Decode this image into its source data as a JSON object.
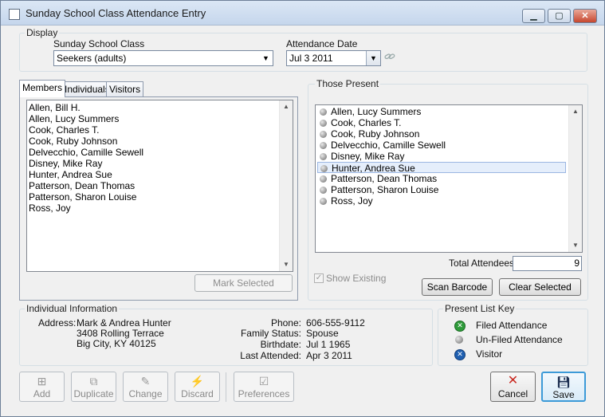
{
  "window": {
    "title": "Sunday School Class Attendance Entry",
    "controls": {
      "minimize": "▁",
      "maximize": "▢",
      "close": "✕"
    }
  },
  "display": {
    "group_label": "Display",
    "class_label": "Sunday School Class",
    "class_value": "Seekers (adults)",
    "date_label": "Attendance Date",
    "date_value": "Jul 3 2011"
  },
  "tabs": [
    "Members",
    "Individuals",
    "Visitors"
  ],
  "members": [
    "Allen, Bill H.",
    "Allen, Lucy Summers",
    "Cook, Charles T.",
    "Cook, Ruby Johnson",
    "Delvecchio, Camille Sewell",
    "Disney, Mike Ray",
    "Hunter, Andrea Sue",
    "Patterson, Dean Thomas",
    "Patterson, Sharon Louise",
    "Ross, Joy"
  ],
  "mark_selected_label": "Mark Selected",
  "present": {
    "group_label": "Those Present",
    "items": [
      "Allen, Lucy Summers",
      "Cook, Charles T.",
      "Cook, Ruby Johnson",
      "Delvecchio, Camille Sewell",
      "Disney, Mike Ray",
      "Hunter, Andrea Sue",
      "Patterson, Dean Thomas",
      "Patterson, Sharon Louise",
      "Ross, Joy"
    ],
    "selected": "Hunter, Andrea Sue",
    "total_label": "Total Attendees:",
    "total_value": "9",
    "show_existing_label": "Show Existing",
    "scan_barcode_label": "Scan Barcode",
    "clear_selected_label": "Clear Selected"
  },
  "individual": {
    "group_label": "Individual Information",
    "address_label": "Address:",
    "address_lines": [
      "Mark & Andrea Hunter",
      "3408 Rolling Terrace",
      "Big City, KY 40125"
    ],
    "phone_label": "Phone:",
    "phone_value": "606-555-9112",
    "family_status_label": "Family Status:",
    "family_status_value": "Spouse",
    "birthdate_label": "Birthdate:",
    "birthdate_value": "Jul 1 1965",
    "last_attended_label": "Last Attended:",
    "last_attended_value": "Apr 3 2011"
  },
  "key": {
    "group_label": "Present List Key",
    "filed": "Filed Attendance",
    "unfiled": "Un-Filed Attendance",
    "visitor": "Visitor",
    "colors": {
      "filed": "#2e9b3a",
      "unfiled": "#8c8c8c",
      "visitor": "#1f5fb0"
    }
  },
  "toolbar": {
    "add": "Add",
    "duplicate": "Duplicate",
    "change": "Change",
    "discard": "Discard",
    "preferences": "Preferences",
    "cancel": "Cancel",
    "save": "Save"
  }
}
